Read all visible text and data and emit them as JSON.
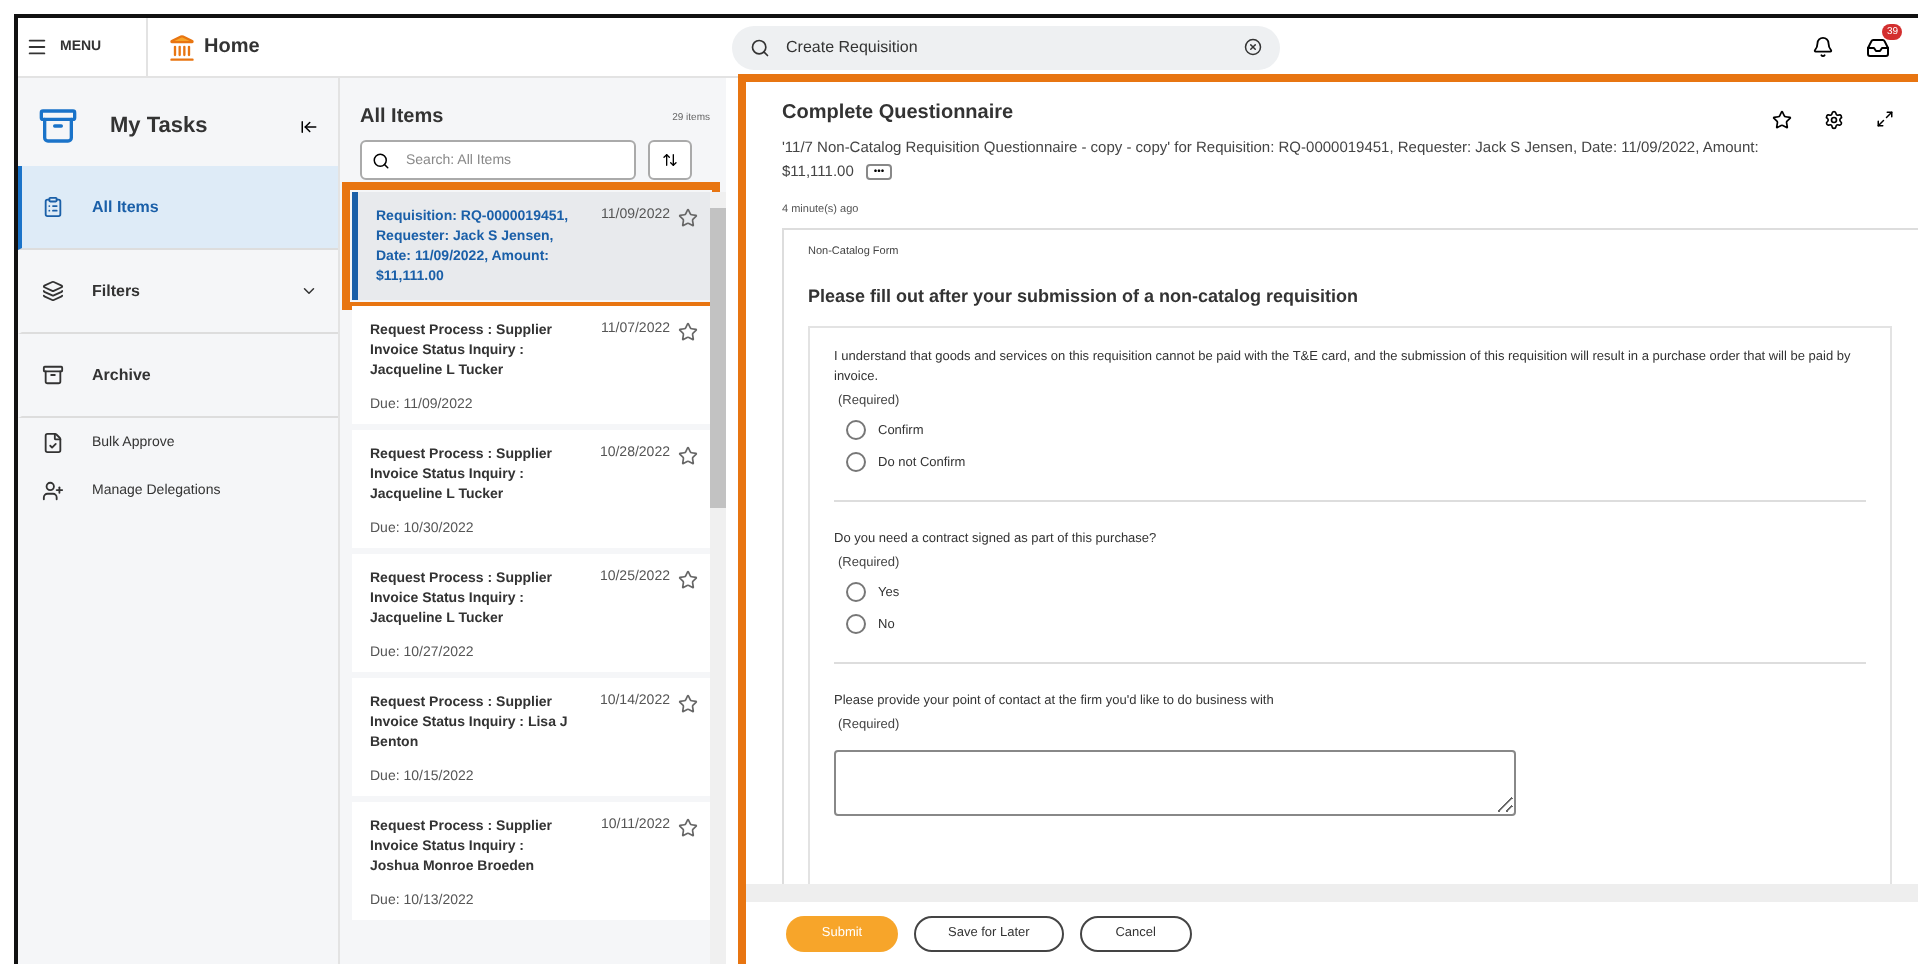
{
  "topbar": {
    "menu_label": "MENU",
    "home_label": "Home",
    "search_value": "Create Requisition",
    "inbox_badge": "39"
  },
  "sidebar": {
    "title": "My Tasks",
    "items": [
      {
        "label": "All Items",
        "selected": true,
        "bold": true
      },
      {
        "label": "Filters",
        "selected": false,
        "bold": true
      },
      {
        "label": "Archive",
        "selected": false,
        "bold": true
      },
      {
        "label": "Bulk Approve",
        "selected": false,
        "bold": false
      },
      {
        "label": "Manage Delegations",
        "selected": false,
        "bold": false
      }
    ]
  },
  "list": {
    "title": "All Items",
    "count": "29 items",
    "search_placeholder": "Search: All Items",
    "items": [
      {
        "title": "Requisition: RQ-0000019451, Requester: Jack S Jensen, Date: 11/09/2022, Amount: $11,111.00",
        "date": "11/09/2022",
        "selected": true
      },
      {
        "title": "Request Process : Supplier Invoice Status Inquiry : Jacqueline L Tucker",
        "date": "11/07/2022",
        "due": "Due: 11/09/2022",
        "selected": false
      },
      {
        "title": "Request Process : Supplier Invoice Status Inquiry : Jacqueline L Tucker",
        "date": "10/28/2022",
        "due": "Due: 10/30/2022",
        "selected": false
      },
      {
        "title": "Request Process : Supplier Invoice Status Inquiry : Jacqueline L Tucker",
        "date": "10/25/2022",
        "due": "Due: 10/27/2022",
        "selected": false
      },
      {
        "title": "Request Process : Supplier Invoice Status Inquiry : Lisa J Benton",
        "date": "10/14/2022",
        "due": "Due: 10/15/2022",
        "selected": false
      },
      {
        "title": "Request Process : Supplier Invoice Status Inquiry : Joshua Monroe Broeden",
        "date": "10/11/2022",
        "due": "Due: 10/13/2022",
        "selected": false
      }
    ]
  },
  "detail": {
    "title": "Complete Questionnaire",
    "subtitle": "'11/7 Non-Catalog Requisition Questionnaire - copy - copy' for Requisition: RQ-0000019451, Requester: Jack S Jensen, Date: 11/09/2022, Amount: $11,111.00",
    "more": "•••",
    "time": "4 minute(s) ago",
    "form": {
      "label": "Non-Catalog Form",
      "heading": "Please fill out after your submission of a non-catalog requisition",
      "questions": [
        {
          "kind": "radio",
          "text": "I understand that goods and services on this requisition cannot be paid with the T&E card, and the submission of this requisition will result in a purchase order that will be paid by invoice.",
          "required": "(Required)",
          "options": [
            {
              "label": "Confirm",
              "selected": false
            },
            {
              "label": "Do not Confirm",
              "selected": false
            }
          ]
        },
        {
          "kind": "radio",
          "text": "Do you need a contract signed as part of this purchase?",
          "required": "(Required)",
          "options": [
            {
              "label": "Yes",
              "selected": false
            },
            {
              "label": "No",
              "selected": false
            }
          ]
        },
        {
          "kind": "text",
          "text": "Please provide your point of contact at the firm you'd like to do business with",
          "required": "(Required)"
        }
      ]
    },
    "buttons": [
      {
        "label": "Submit",
        "kind": "primary"
      },
      {
        "label": "Save for Later",
        "kind": "secondary"
      },
      {
        "label": "Cancel",
        "kind": "secondary"
      }
    ]
  }
}
